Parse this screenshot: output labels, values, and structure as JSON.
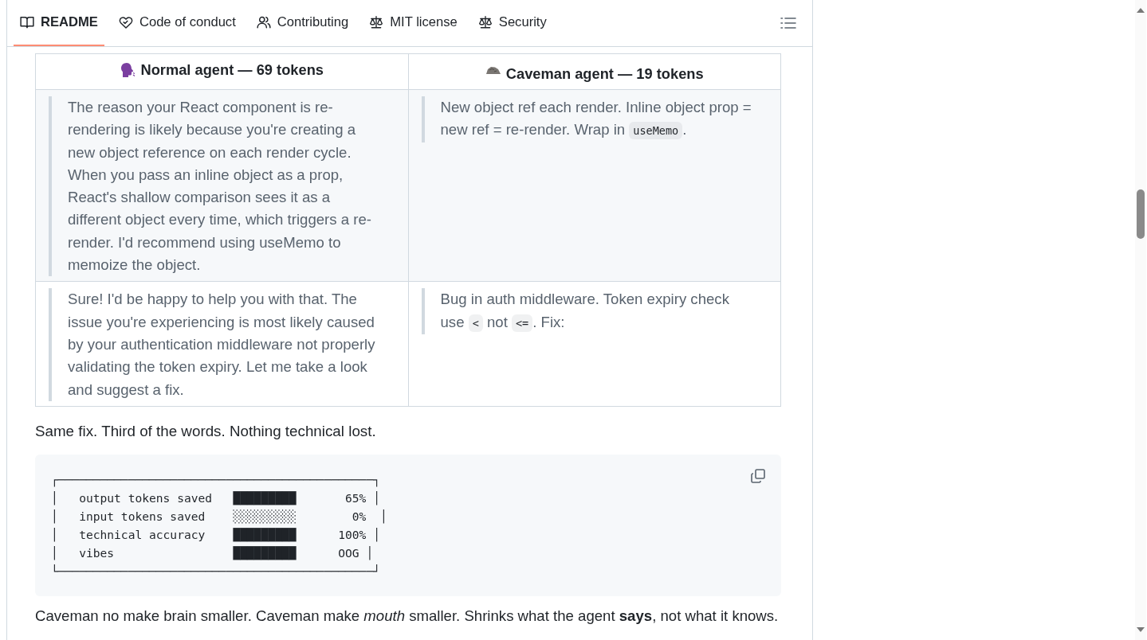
{
  "tabs": [
    {
      "label": "README",
      "selected": true
    },
    {
      "label": "Code of conduct",
      "selected": false
    },
    {
      "label": "Contributing",
      "selected": false
    },
    {
      "label": "MIT license",
      "selected": false
    },
    {
      "label": "Security",
      "selected": false
    }
  ],
  "table": {
    "columns": [
      {
        "label": "Normal agent — 69 tokens"
      },
      {
        "label": "Caveman agent — 19 tokens"
      }
    ],
    "rows": [
      [
        [
          {
            "kind": "text",
            "text": "The reason your React component is re-rendering is likely because you're creating a new object reference on each render cycle. When you pass an inline object as a prop, React's shallow comparison sees it as a different object every time, which triggers a re-render. I'd recommend using useMemo to memoize the object."
          }
        ],
        [
          {
            "kind": "text",
            "text": "New object ref each render. Inline object prop = new ref = re-render. Wrap in "
          },
          {
            "kind": "code",
            "text": "useMemo"
          },
          {
            "kind": "text",
            "text": "."
          }
        ]
      ],
      [
        [
          {
            "kind": "text",
            "text": "Sure! I'd be happy to help you with that. The issue you're experiencing is most likely caused by your authentication middleware not properly validating the token expiry. Let me take a look and suggest a fix."
          }
        ],
        [
          {
            "kind": "text",
            "text": "Bug in auth middleware. Token expiry check use "
          },
          {
            "kind": "code",
            "text": "<"
          },
          {
            "kind": "text",
            "text": " not "
          },
          {
            "kind": "code",
            "text": "<="
          },
          {
            "kind": "text",
            "text": ". Fix:"
          }
        ]
      ]
    ]
  },
  "summary": "Same fix. Third of the words. Nothing technical lost.",
  "code_block": {
    "lines": [
      "┌─────────────────────────────────────────────┐",
      "│   output tokens saved   █████████       65% │",
      "│   input tokens saved    ░░░░░░░░░        0%  │",
      "│   technical accuracy    █████████      100% │",
      "│   vibes                 █████████      OOG │",
      "└─────────────────────────────────────────────┘"
    ]
  },
  "closing": "Caveman no make brain smaller. Caveman make *mouth* smaller. Shrinks what the agent **says**, not what it knows."
}
